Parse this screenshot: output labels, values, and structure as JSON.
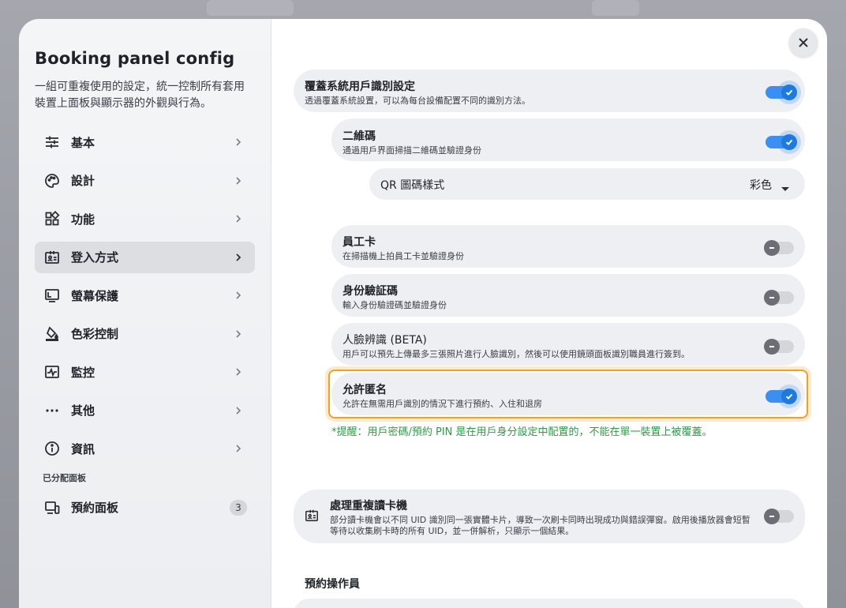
{
  "sidebar": {
    "title": "Booking panel config",
    "description": "一組可重複使用的設定，統一控制所有套用裝置上面板與顯示器的外觀與行為。",
    "items": [
      {
        "label": "基本",
        "icon": "sliders-icon"
      },
      {
        "label": "設計",
        "icon": "palette-icon"
      },
      {
        "label": "功能",
        "icon": "grid-icon"
      },
      {
        "label": "登入方式",
        "icon": "id-card-icon"
      },
      {
        "label": "螢幕保護",
        "icon": "monitor-icon"
      },
      {
        "label": "色彩控制",
        "icon": "paint-bucket-icon"
      },
      {
        "label": "監控",
        "icon": "pulse-icon"
      },
      {
        "label": "其他",
        "icon": "more-icon"
      },
      {
        "label": "資訊",
        "icon": "info-icon"
      }
    ],
    "active_item": "登入方式",
    "section_label": "已分配面板",
    "assigned": {
      "label": "預約面板",
      "count": "3"
    }
  },
  "main": {
    "override": {
      "title": "覆蓋系統用戶識別設定",
      "desc": "透過覆蓋系統設置，可以為每台設備配置不同的識別方法。",
      "enabled": true
    },
    "qr": {
      "title": "二維碼",
      "desc": "通過用戶界面掃描二維碼並驗證身份",
      "enabled": true
    },
    "qr_style": {
      "label": "QR 圖碼樣式",
      "value": "彩色"
    },
    "staff_card": {
      "title": "員工卡",
      "desc": "在掃描機上拍員工卡並驗證身份",
      "enabled": false
    },
    "id_code": {
      "title": "身份驗証碼",
      "desc": "輸入身份驗證碼並驗證身份",
      "enabled": false
    },
    "face": {
      "title": "人臉辨識 (BETA)",
      "desc": "用戶可以預先上傳最多三張照片進行人臉識別，然後可以使用鏡頭面板識別職員進行簽到。",
      "enabled": false
    },
    "anonymous": {
      "title": "允許匿名",
      "desc": "允許在無需用戶識別的情況下進行預約、入住和退房",
      "enabled": true
    },
    "hint": "*提醒：用戶密碼/預約 PIN 是在用戶身分設定中配置的，不能在單一裝置上被覆蓋。",
    "duplicate_reader": {
      "title": "處理重複讀卡機",
      "desc_line1": "部分讀卡機會以不同 UID 識別同一張實體卡片，導致一次刷卡同時出現成功與錯誤彈窗。啟用後播放器會短暫",
      "desc_line2": "等待以收集刷卡時的所有 UID，並一併解析，只顯示一個結果。",
      "enabled": false
    },
    "operator_section": "預約操作員"
  },
  "colors": {
    "accent": "#1f7ae0",
    "highlight": "#f0a026",
    "hint": "#2f9a47"
  }
}
